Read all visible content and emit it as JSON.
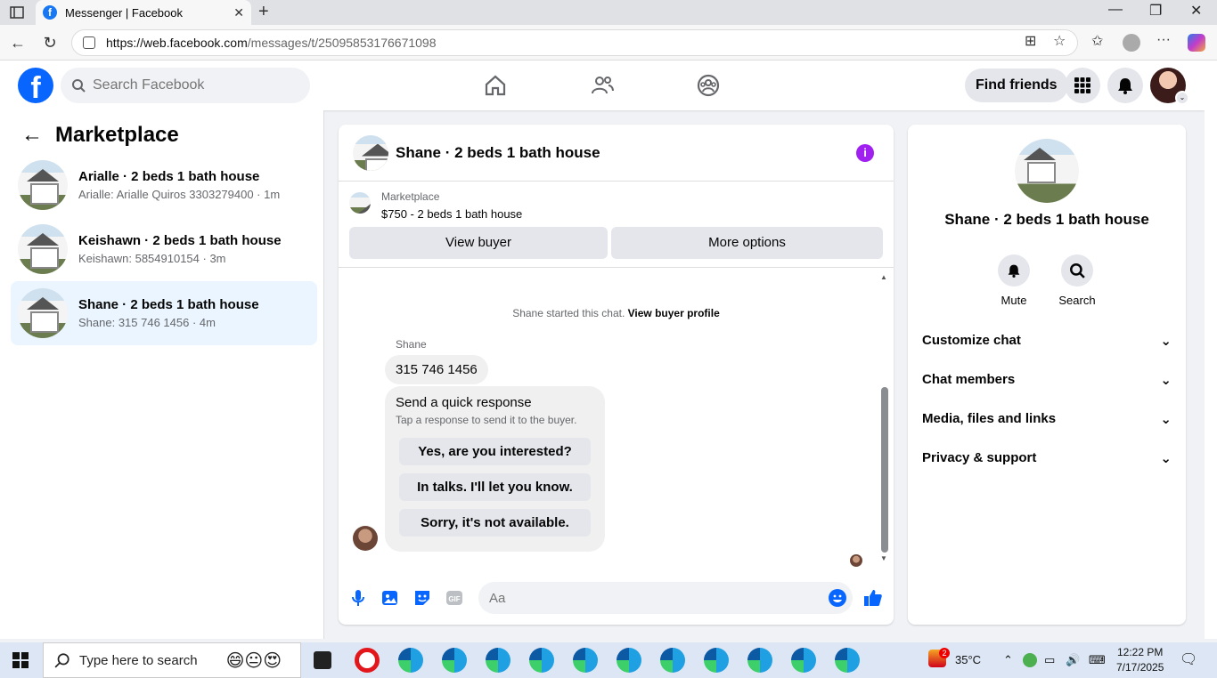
{
  "browser": {
    "tab_title": "Messenger | Facebook",
    "url_host": "https://web.facebook.com",
    "url_path": "/messages/t/25095853176671098"
  },
  "fb": {
    "search_placeholder": "Search Facebook",
    "find_friends": "Find friends"
  },
  "sidebar": {
    "title": "Marketplace",
    "conversations": [
      {
        "name": "Arialle · 2 beds 1 bath house",
        "sub": "Arialle: Arialle Quiros 3303279400 · 1m"
      },
      {
        "name": "Keishawn · 2 beds 1 bath house",
        "sub": "Keishawn: 5854910154 · 3m"
      },
      {
        "name": "Shane · 2 beds 1 bath house",
        "sub": "Shane: 315 746 1456 · 4m"
      }
    ]
  },
  "chat": {
    "title": "Shane · 2 beds 1 bath house",
    "marketplace_label": "Marketplace",
    "listing": "$750 - 2 beds 1 bath house",
    "view_buyer": "View buyer",
    "more_options": "More options",
    "started_text": "Shane started this chat.",
    "view_buyer_profile": "View buyer profile",
    "sender": "Shane",
    "message": "315 746 1456",
    "quick_title": "Send a quick response",
    "quick_sub": "Tap a response to send it to the buyer.",
    "quick_replies": [
      "Yes, are you interested?",
      "In talks. I'll let you know.",
      "Sorry, it's not available."
    ],
    "composer_placeholder": "Aa"
  },
  "info_panel": {
    "name": "Shane · 2 beds 1 bath house",
    "mute": "Mute",
    "search": "Search",
    "sections": [
      "Customize chat",
      "Chat members",
      "Media, files and links",
      "Privacy & support"
    ]
  },
  "taskbar": {
    "search_placeholder": "Type here to search",
    "weather": "35°C",
    "notif_badge": "2",
    "time": "12:22 PM",
    "date": "7/17/2025"
  },
  "colors": {
    "fb_blue": "#0866ff",
    "messenger_accent": "#a020f0",
    "active_conv": "#ebf5ff"
  }
}
